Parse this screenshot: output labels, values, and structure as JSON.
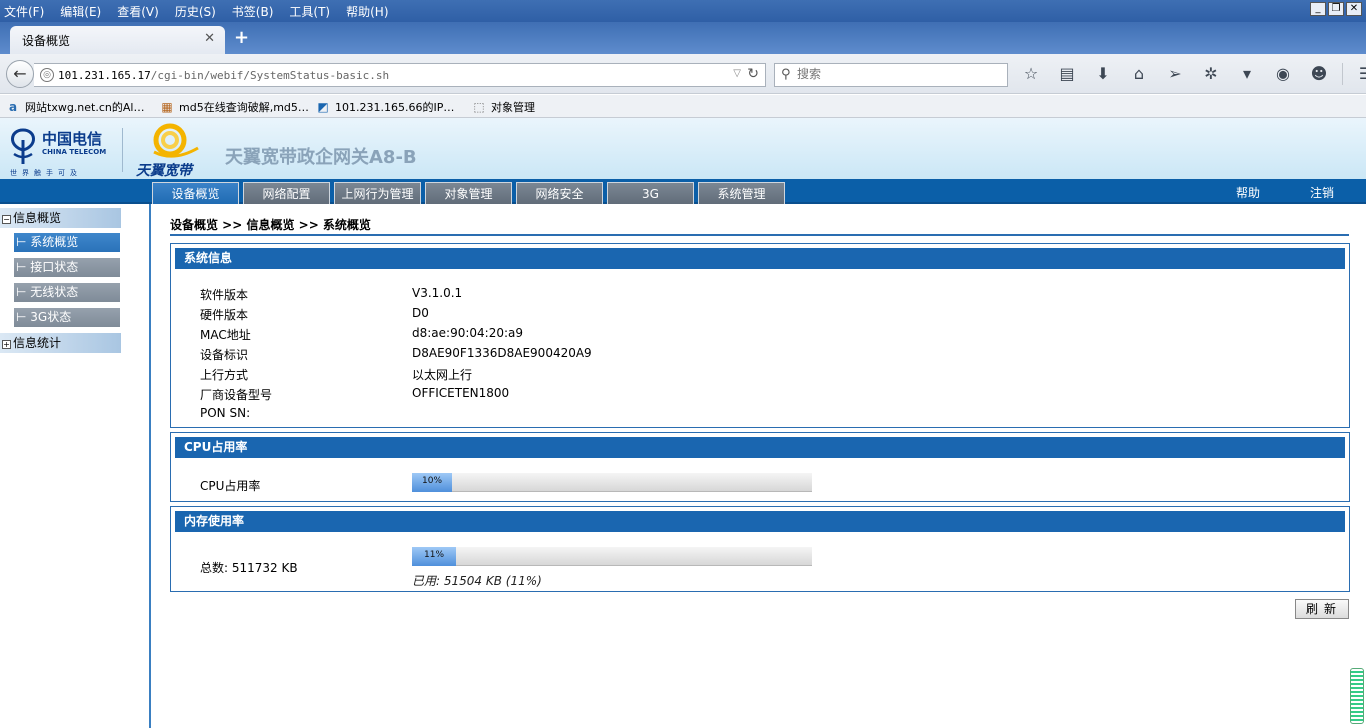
{
  "browser": {
    "menus": [
      "文件(F)",
      "编辑(E)",
      "查看(V)",
      "历史(S)",
      "书签(B)",
      "工具(T)",
      "帮助(H)"
    ],
    "tab_title": "设备概览",
    "url_host": "101.231.165.17",
    "url_path": "/cgi-bin/webif/SystemStatus-basic.sh",
    "search_placeholder": "搜索",
    "bookmarks": [
      "网站txwg.net.cn的Al…",
      "md5在线查询破解,md5…",
      "101.231.165.66的IP…",
      "对象管理"
    ]
  },
  "header": {
    "logo_cn": "中国电信",
    "logo_en": "CHINA TELECOM",
    "logo_slogan": "世界触手可及",
    "brand": "天翼宽带",
    "product_title": "天翼宽带政企网关A8-B"
  },
  "mainnav": {
    "tabs": [
      "设备概览",
      "网络配置",
      "上网行为管理",
      "对象管理",
      "网络安全",
      "3G",
      "系统管理"
    ],
    "help": "帮助",
    "logout": "注销"
  },
  "sidebar": {
    "group1": "信息概览",
    "items": [
      "系统概览",
      "接口状态",
      "无线状态",
      "3G状态"
    ],
    "group2": "信息统计"
  },
  "breadcrumb": "设备概览 >> 信息概览 >> 系统概览",
  "system_info": {
    "title": "系统信息",
    "rows": [
      {
        "label": "软件版本",
        "value": "V3.1.0.1"
      },
      {
        "label": "硬件版本",
        "value": "D0"
      },
      {
        "label": "MAC地址",
        "value": "d8:ae:90:04:20:a9"
      },
      {
        "label": "设备标识",
        "value": "D8AE90F1336D8AE900420A9"
      },
      {
        "label": "上行方式",
        "value": "以太网上行"
      },
      {
        "label": "厂商设备型号",
        "value": "OFFICETEN1800"
      },
      {
        "label": "PON SN:",
        "value": ""
      }
    ]
  },
  "cpu": {
    "title": "CPU占用率",
    "label": "CPU占用率",
    "percent": 10,
    "percent_text": "10%"
  },
  "memory": {
    "title": "内存使用率",
    "total_label": "总数: 511732 KB",
    "percent": 11,
    "percent_text": "11%",
    "used_text": "已用: 51504 KB (11%)"
  },
  "refresh_label": "刷新"
}
